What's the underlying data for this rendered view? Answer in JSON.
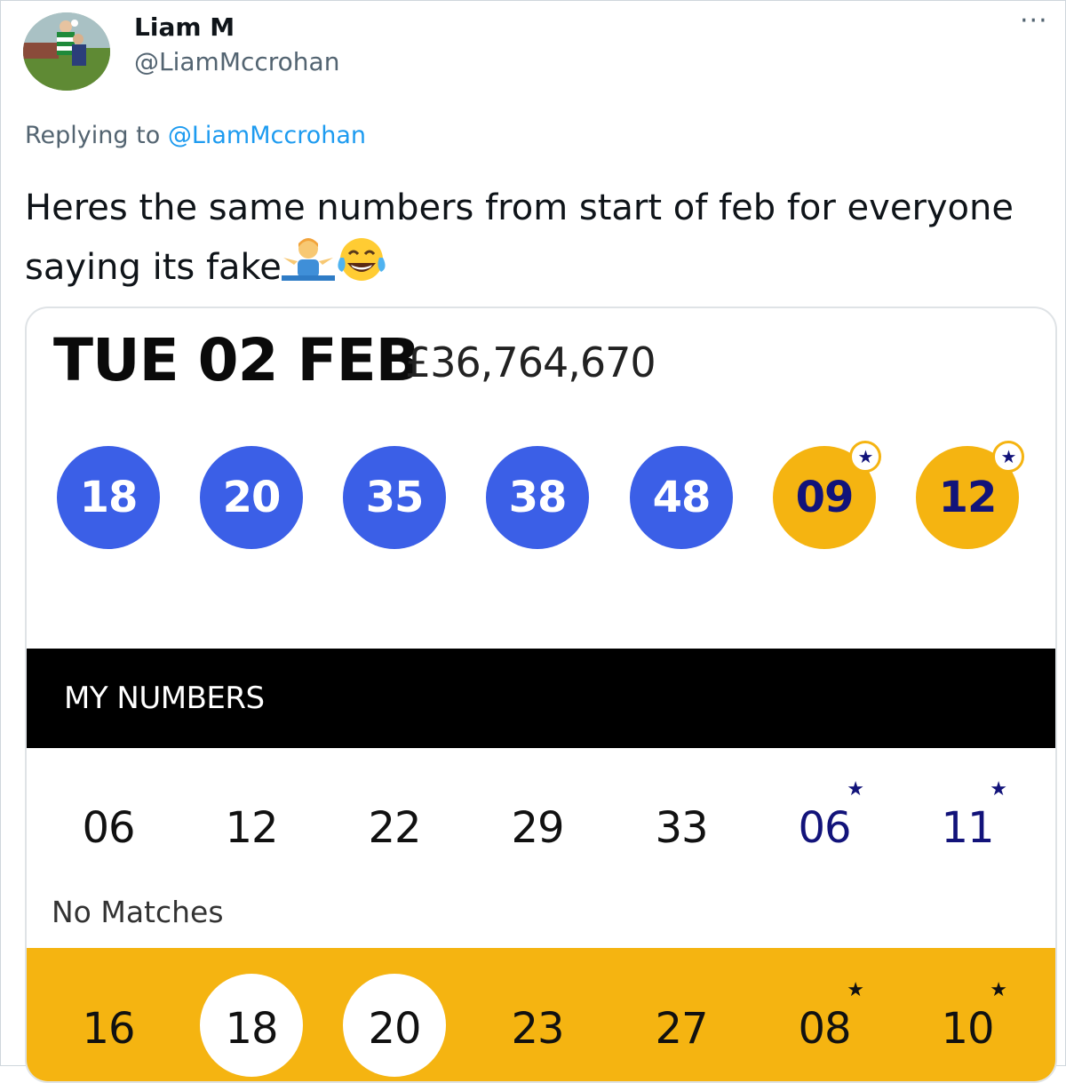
{
  "tweet": {
    "author_name": "Liam M",
    "author_handle": "@LiamMccrohan",
    "more_label": "···",
    "replying_prefix": "Replying to ",
    "replying_to": "@LiamMccrohan",
    "text_line1": "Heres the same numbers from start of feb for everyone",
    "text_line2": "saying its fake",
    "emojis": [
      "person-shrugging-emoji",
      "face-with-tears-of-joy-emoji"
    ]
  },
  "result_card": {
    "draw_date": "TUE 02 FEB",
    "jackpot": "£36,764,670",
    "main_balls": [
      "18",
      "20",
      "35",
      "38",
      "48"
    ],
    "lucky_stars": [
      "09",
      "12"
    ],
    "star_glyph": "★",
    "my_numbers_label": "MY NUMBERS",
    "line1": {
      "main": [
        "06",
        "12",
        "22",
        "29",
        "33"
      ],
      "stars": [
        "06",
        "11"
      ],
      "status": "No Matches"
    },
    "line2": {
      "main": [
        "16",
        "18",
        "20",
        "23",
        "27"
      ],
      "stars": [
        "08",
        "10"
      ],
      "matched": [
        "18",
        "20"
      ]
    }
  },
  "colors": {
    "main_ball": "#3b5fe7",
    "lucky_star": "#f5b411",
    "star_text": "#12137a",
    "link": "#1d9bf0"
  }
}
